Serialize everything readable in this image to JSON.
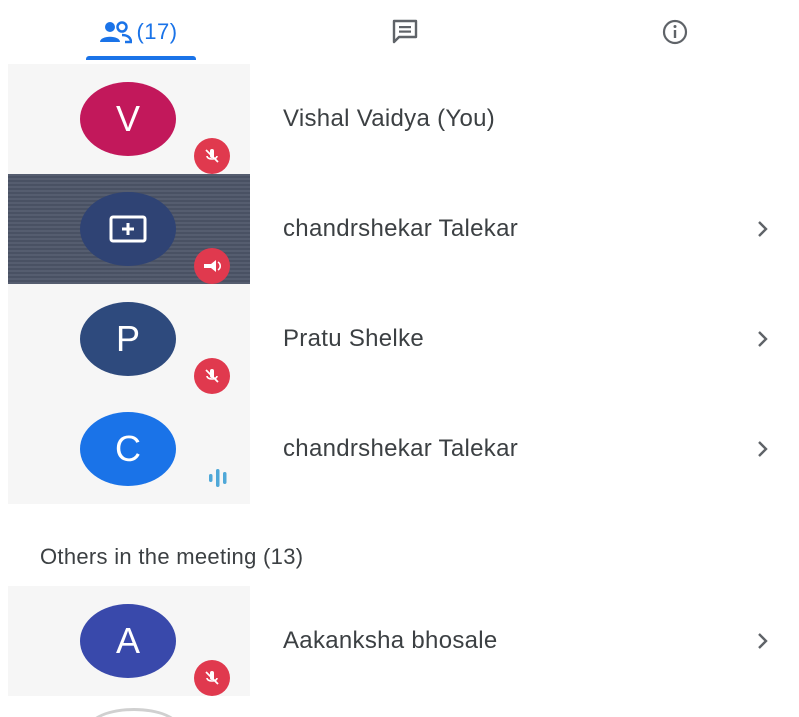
{
  "tabs": {
    "people": {
      "icon": "people-icon",
      "count": "(17)"
    },
    "chat": {
      "icon": "chat-icon"
    },
    "info": {
      "icon": "info-icon"
    }
  },
  "participants": [
    {
      "initial": "V",
      "name": "Vishal Vaidya (You)",
      "avatar_color": "#c2185b",
      "status_icon": "mic-off-icon",
      "has_chevron": false
    },
    {
      "initial": "",
      "name": "chandrshekar Talekar",
      "avatar_color": "#2f4374",
      "status_icon": "presenting-icon",
      "has_chevron": true
    },
    {
      "initial": "P",
      "name": "Pratu Shelke",
      "avatar_color": "#2e4a7d",
      "status_icon": "mic-off-icon",
      "has_chevron": true
    },
    {
      "initial": "C",
      "name": "chandrshekar Talekar",
      "avatar_color": "#1a73e8",
      "status_icon": "speaking-icon",
      "has_chevron": true
    }
  ],
  "others_section": {
    "heading": "Others in the meeting (13)",
    "participants": [
      {
        "initial": "A",
        "name": "Aakanksha bhosale",
        "avatar_color": "#3949ab",
        "status_icon": "mic-off-icon",
        "has_chevron": true
      }
    ]
  },
  "colors": {
    "accent": "#1a73e8",
    "muted_badge": "#e0394e",
    "active_row": "#4c5467"
  }
}
